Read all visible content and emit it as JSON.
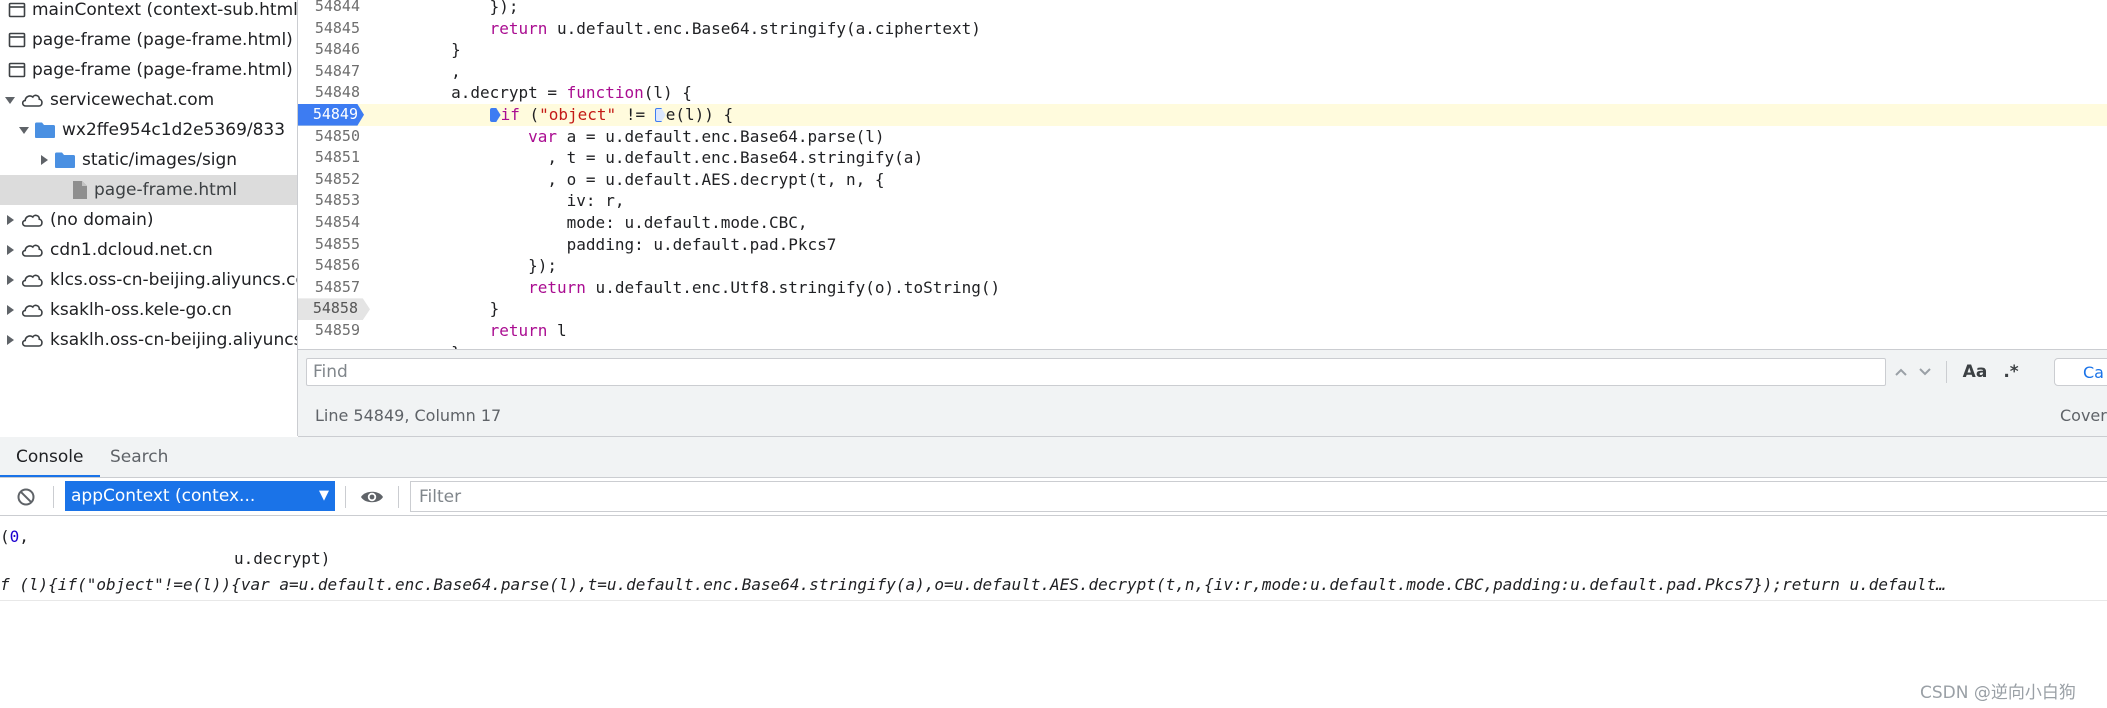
{
  "tree": {
    "items": [
      {
        "label": "mainContext (context-sub.html)",
        "icon": "frame-icon",
        "depth": 0,
        "expander": "none"
      },
      {
        "label": "page-frame (page-frame.html)",
        "icon": "frame-icon",
        "depth": 0,
        "expander": "none"
      },
      {
        "label": "page-frame (page-frame.html)",
        "icon": "frame-icon",
        "depth": 0,
        "expander": "none"
      },
      {
        "label": "servicewechat.com",
        "icon": "cloud-icon",
        "depth": 0,
        "expander": "expanded"
      },
      {
        "label": "wx2ffe954c1d2e5369/833",
        "icon": "folder-icon",
        "depth": 1,
        "expander": "expanded"
      },
      {
        "label": "static/images/sign",
        "icon": "folder-icon",
        "depth": 2,
        "expander": "collapsed"
      },
      {
        "label": "page-frame.html",
        "icon": "file-icon",
        "depth": 3,
        "expander": "none",
        "selected": true
      },
      {
        "label": "(no domain)",
        "icon": "cloud-icon",
        "depth": 0,
        "expander": "collapsed"
      },
      {
        "label": "cdn1.dcloud.net.cn",
        "icon": "cloud-icon",
        "depth": 0,
        "expander": "collapsed"
      },
      {
        "label": "klcs.oss-cn-beijing.aliyuncs.com",
        "icon": "cloud-icon",
        "depth": 0,
        "expander": "collapsed"
      },
      {
        "label": "ksaklh-oss.kele-go.cn",
        "icon": "cloud-icon",
        "depth": 0,
        "expander": "collapsed"
      },
      {
        "label": "ksaklh.oss-cn-beijing.aliyuncs.com",
        "icon": "cloud-icon",
        "depth": 0,
        "expander": "collapsed"
      }
    ]
  },
  "editor": {
    "lines": [
      {
        "num": "54844",
        "parts": [
          {
            "t": "            });"
          }
        ]
      },
      {
        "num": "54845",
        "parts": [
          {
            "t": "            "
          },
          {
            "t": "return",
            "c": "kw"
          },
          {
            "t": " u.default.enc.Base64.stringify(a.ciphertext)"
          }
        ]
      },
      {
        "num": "54846",
        "parts": [
          {
            "t": "        }"
          }
        ]
      },
      {
        "num": "54847",
        "parts": [
          {
            "t": "        ,"
          }
        ]
      },
      {
        "num": "54848",
        "parts": [
          {
            "t": "        a.decrypt = "
          },
          {
            "t": "function",
            "c": "kw"
          },
          {
            "t": "(l) {"
          }
        ]
      },
      {
        "num": "54849",
        "bp": "blue",
        "current": true,
        "parts": [
          {
            "t": "            "
          },
          {
            "bp": "solid"
          },
          {
            "t": "if",
            "c": "kw"
          },
          {
            "t": " ("
          },
          {
            "t": "\"object\"",
            "c": "str"
          },
          {
            "t": " != "
          },
          {
            "bp": "hollow"
          },
          {
            "t": "e(l)) {"
          }
        ]
      },
      {
        "num": "54850",
        "parts": [
          {
            "t": "                "
          },
          {
            "t": "var",
            "c": "kw"
          },
          {
            "t": " a = u.default.enc.Base64.parse(l)"
          }
        ]
      },
      {
        "num": "54851",
        "parts": [
          {
            "t": "                  , t = u.default.enc.Base64.stringify(a)"
          }
        ]
      },
      {
        "num": "54852",
        "parts": [
          {
            "t": "                  , o = u.default.AES.decrypt(t, n, {"
          }
        ]
      },
      {
        "num": "54853",
        "parts": [
          {
            "t": "                    iv: r,"
          }
        ]
      },
      {
        "num": "54854",
        "parts": [
          {
            "t": "                    mode: u.default.mode.CBC,"
          }
        ]
      },
      {
        "num": "54855",
        "parts": [
          {
            "t": "                    padding: u.default.pad.Pkcs7"
          }
        ]
      },
      {
        "num": "54856",
        "parts": [
          {
            "t": "                });"
          }
        ]
      },
      {
        "num": "54857",
        "parts": [
          {
            "t": "                "
          },
          {
            "t": "return",
            "c": "kw"
          },
          {
            "t": " u.default.enc.Utf8.stringify(o).toString()"
          }
        ]
      },
      {
        "num": "54858",
        "bp": "gray",
        "parts": [
          {
            "t": "            }"
          }
        ]
      },
      {
        "num": "54859",
        "parts": [
          {
            "t": "            "
          },
          {
            "t": "return",
            "c": "kw"
          },
          {
            "t": " l"
          }
        ]
      },
      {
        "num": "",
        "parts": [
          {
            "t": "        }"
          }
        ]
      }
    ]
  },
  "findbar": {
    "placeholder": "Find",
    "prev_icon": "chevron-up-icon",
    "next_icon": "chevron-down-icon",
    "match_case": "Aa",
    "regex": ".*",
    "cancel": "Ca"
  },
  "status": {
    "position": "Line 54849, Column 17",
    "coverage": "Covera"
  },
  "drawer": {
    "tabs": [
      {
        "label": "Console",
        "active": true
      },
      {
        "label": "Search",
        "active": false
      }
    ]
  },
  "console": {
    "context": "appContext (contex...",
    "filter_placeholder": "Filter",
    "output": {
      "line1_paren": "(",
      "line1_num": "0",
      "line1_comma": ",",
      "line2": "u.decrypt)",
      "line3": "f (l){if(\"object\"!=e(l)){var a=u.default.enc.Base64.parse(l),t=u.default.enc.Base64.stringify(a),o=u.default.AES.decrypt(t,n,{iv:r,mode:u.default.mode.CBC,padding:u.default.pad.Pkcs7});return u.default…"
    }
  },
  "watermark": "CSDN @逆向小白狗",
  "colors": {
    "accent": "#1a73e8",
    "breakpoint": "#3d7cf2",
    "keyword": "#aa0d91",
    "string": "#c41a16",
    "number": "#1c00cf",
    "current_line": "#fffbdd"
  }
}
